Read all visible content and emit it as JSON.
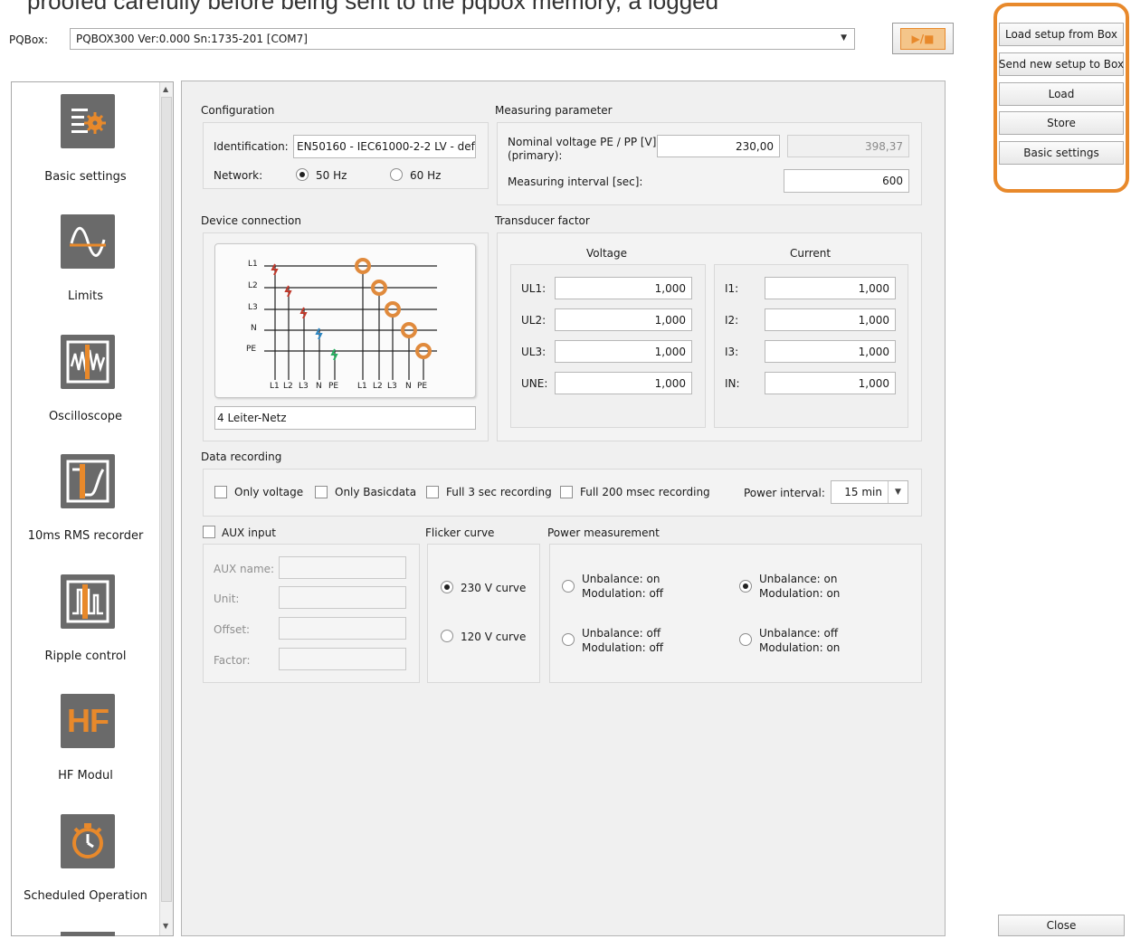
{
  "window": {
    "top_crop_text": "proofed carefully before being sent to the pqbox memory, a logged"
  },
  "device_selector": {
    "label": "PQBox:",
    "value": "PQBOX300 Ver:0.000 Sn:1735-201 [COM7]",
    "play_stop_glyph": "▶/■"
  },
  "sidebar": {
    "items": [
      {
        "label": "Basic settings",
        "icon": "basic-settings-icon"
      },
      {
        "label": "Limits",
        "icon": "limits-icon"
      },
      {
        "label": "Oscilloscope",
        "icon": "oscilloscope-icon"
      },
      {
        "label": "10ms RMS recorder",
        "icon": "rms-recorder-icon"
      },
      {
        "label": "Ripple control",
        "icon": "ripple-control-icon"
      },
      {
        "label": "HF Modul",
        "icon": "hf-module-icon"
      },
      {
        "label": "Scheduled Operation",
        "icon": "stopwatch-icon"
      }
    ]
  },
  "configuration": {
    "title": "Configuration",
    "identification_label": "Identification:",
    "identification_value": "EN50160 - IEC61000-2-2 LV - def",
    "network_label": "Network:",
    "options": [
      "50 Hz",
      "60 Hz"
    ],
    "selected": "50 Hz"
  },
  "measuring": {
    "title": "Measuring parameter",
    "nominal_label_1": "Nominal voltage PE / PP [V]",
    "nominal_label_2": "(primary):",
    "nominal_value": "230,00",
    "nominal_pp_value": "398,37",
    "interval_label": "Measuring interval [sec]:",
    "interval_value": "600"
  },
  "device_connection": {
    "title": "Device connection",
    "lines": [
      "L1",
      "L2",
      "L3",
      "N",
      "PE"
    ],
    "bottom_labels_left": [
      "L1",
      "L2",
      "L3",
      "N",
      "PE"
    ],
    "bottom_labels_right": [
      "L1",
      "L2",
      "L3",
      "N",
      "PE"
    ],
    "network_type": "4 Leiter-Netz",
    "colors": {
      "l1": "#c0392b",
      "l2": "#c0392b",
      "l3": "#c0392b",
      "n": "#2e86c1",
      "pe": "#27ae60",
      "clamp": "#e08a3c"
    }
  },
  "transducer": {
    "title": "Transducer factor",
    "voltage_header": "Voltage",
    "current_header": "Current",
    "voltage": [
      {
        "label": "UL1:",
        "value": "1,000"
      },
      {
        "label": "UL2:",
        "value": "1,000"
      },
      {
        "label": "UL3:",
        "value": "1,000"
      },
      {
        "label": "UNE:",
        "value": "1,000"
      }
    ],
    "current": [
      {
        "label": "I1:",
        "value": "1,000"
      },
      {
        "label": "I2:",
        "value": "1,000"
      },
      {
        "label": "I3:",
        "value": "1,000"
      },
      {
        "label": "IN:",
        "value": "1,000"
      }
    ]
  },
  "data_recording": {
    "title": "Data recording",
    "checkboxes": [
      "Only voltage",
      "Only Basicdata",
      "Full 3 sec recording",
      "Full 200 msec recording"
    ],
    "power_interval_label": "Power interval:",
    "power_interval_value": "15 min"
  },
  "aux": {
    "checkbox_label": "AUX input",
    "fields": [
      "AUX name:",
      "Unit:",
      "Offset:",
      "Factor:"
    ]
  },
  "flicker": {
    "title": "Flicker curve",
    "options": [
      "230 V curve",
      "120 V curve"
    ],
    "selected": "230 V curve"
  },
  "power_measurement": {
    "title": "Power measurement",
    "options": [
      {
        "line1": "Unbalance: on",
        "line2": "Modulation: off"
      },
      {
        "line1": "Unbalance: on",
        "line2": "Modulation: on"
      },
      {
        "line1": "Unbalance: off",
        "line2": "Modulation: off"
      },
      {
        "line1": "Unbalance: off",
        "line2": "Modulation: on"
      }
    ],
    "selected_index": 1
  },
  "actions": {
    "load_from_box": "Load setup from Box",
    "send_to_box": "Send new setup to Box",
    "load": "Load",
    "store": "Store",
    "basic_settings": "Basic settings",
    "close": "Close",
    "highlight_color": "#e8892b"
  }
}
